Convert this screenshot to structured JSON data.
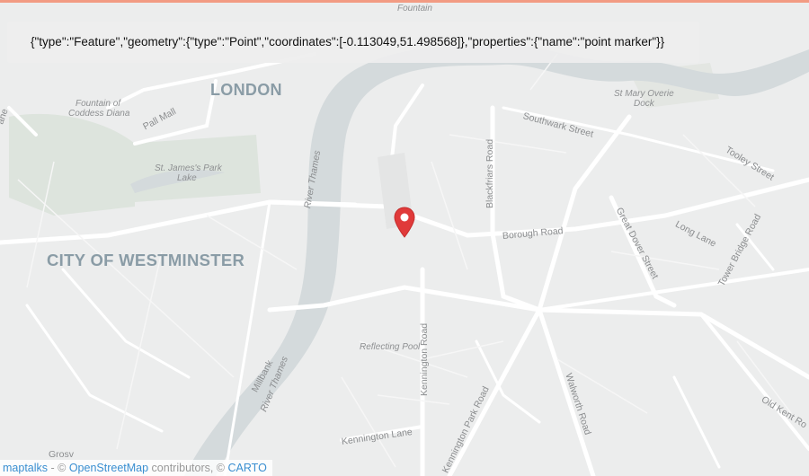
{
  "geojson_text": "{\"type\":\"Feature\",\"geometry\":{\"type\":\"Point\",\"coordinates\":[-0.113049,51.498568]},\"properties\":{\"name\":\"point marker\"}}",
  "map": {
    "places": {
      "london": "LONDON",
      "westminster": "CITY OF WESTMINSTER"
    },
    "pois": {
      "fountain_top": "Fountain",
      "fountain_diana_1": "Fountain of",
      "fountain_diana_2": "Coddess Diana",
      "st_james_lake_1": "St. James's Park",
      "st_james_lake_2": "Lake",
      "st_mary_1": "St Mary Overie",
      "st_mary_2": "Dock",
      "reflecting_pool": "Reflecting Pool"
    },
    "streets": {
      "pall_mall": "Pall Mall",
      "river_thames_1": "River Thames",
      "river_thames_2": "River Thames",
      "millbank": "Millbank",
      "blackfriars": "Blackfriars Road",
      "southwark": "Southwark Street",
      "borough": "Borough Road",
      "great_dover": "Great Dover Street",
      "long_lane": "Long Lane",
      "tower_bridge": "Tower Bridge Road",
      "tooley": "Tooley Street",
      "kennington_road": "Kennington Road",
      "kennington_park": "Kennington Park Road",
      "kennington_lane": "Kennington Lane",
      "walworth": "Walworth Road",
      "old_kent": "Old Kent Ro",
      "lane_left": "ane",
      "grosvenor": "Grosv"
    },
    "marker_name": "point marker",
    "colors": {
      "land": "#eceded",
      "water": "#d4dadc",
      "park": "#dde4dd",
      "road": "#ffffff",
      "marker": "#e03a3a",
      "accent_bar": "#f29b83"
    }
  },
  "attribution": {
    "maptalks": "maptalks",
    "sep": " - © ",
    "osm": "OpenStreetMap",
    "contrib": " contributors, © ",
    "carto": "CARTO"
  }
}
